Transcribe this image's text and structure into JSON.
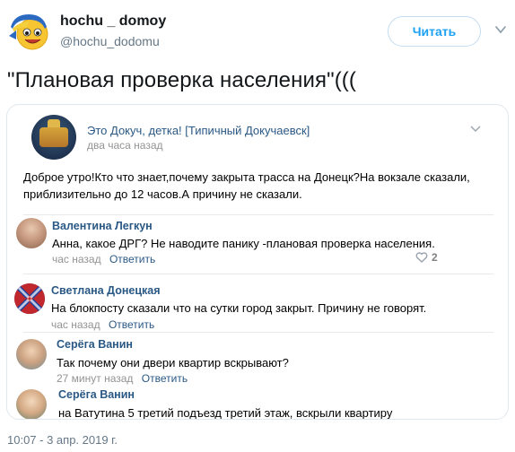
{
  "tweet": {
    "display_name": "hochu _ domoy",
    "handle": "@hochu_dodomu",
    "follow_label": "Читать",
    "text": "\"Плановая проверка населения\"(((",
    "timestamp": "10:07 - 3 апр. 2019 г."
  },
  "screenshot": {
    "group_name": "Это Докуч, детка! [Типичный Докучаевск]",
    "post_time": "два часа назад",
    "post_text": "Доброе утро!Кто что знает,почему закрыта трасса на Донецк?На вокзале сказали, приблизительно до 12 часов.А причину не сказали.",
    "comments": [
      {
        "author": "Валентина Легкун",
        "text": "Анна, какое ДРГ? Не наводите панику -плановая проверка населения.",
        "time": "час назад",
        "reply": "Ответить",
        "likes": "2"
      },
      {
        "author": "Светлана Донецкая",
        "text": "На блокпосту сказали что на сутки город закрыт. Причину не говорят.",
        "time": "час назад",
        "reply": "Ответить"
      },
      {
        "author": "Серёга Ванин",
        "text": "Так почему они двери квартир вскрывают?",
        "time": "27 минут назад",
        "reply": "Ответить"
      },
      {
        "author": "Серёга Ванин",
        "text": "на Ватутина 5 третий подъезд третий этаж, вскрыли квартиру"
      }
    ]
  },
  "colors": {
    "twitter_blue": "#1da1f2",
    "vk_link": "#2a5885",
    "muted": "#657786",
    "vk_muted": "#939393"
  },
  "icons": {
    "avatar": "smiley-avatar",
    "caret": "chevron-down-icon",
    "like": "heart-icon"
  }
}
